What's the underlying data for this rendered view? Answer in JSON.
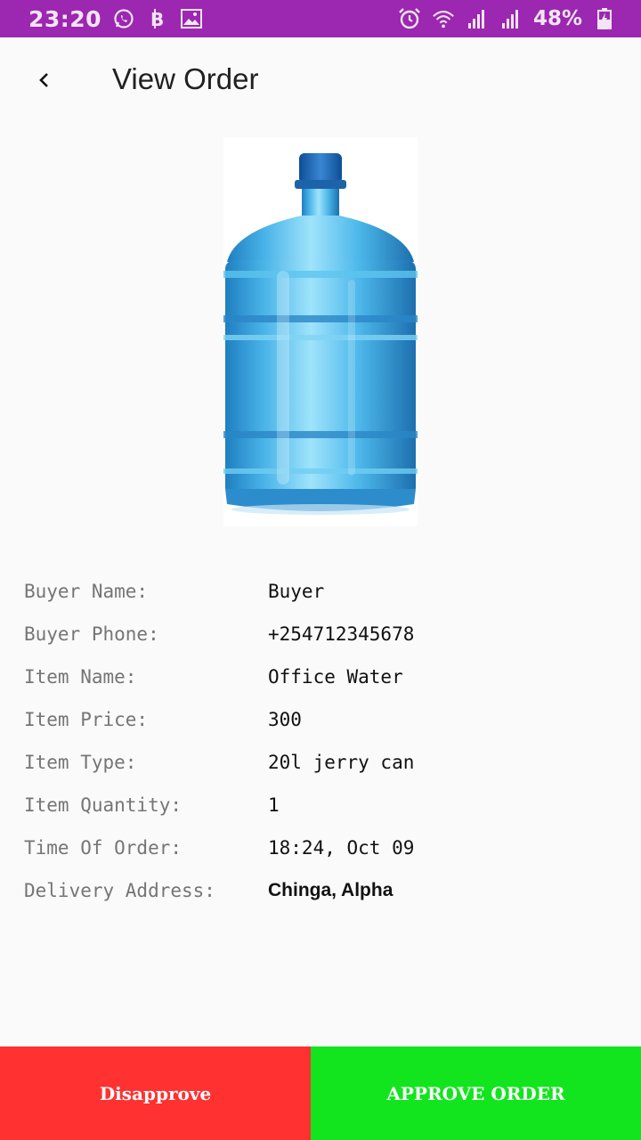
{
  "status_bar": {
    "time": "23:20",
    "battery": "48%",
    "icons_left": [
      "whatsapp-icon",
      "bitcoin-icon",
      "image-icon"
    ],
    "icons_right": [
      "alarm-icon",
      "wifi-icon",
      "signal-icon",
      "signal-icon",
      "battery-charging-icon"
    ],
    "color": "#9c27b0"
  },
  "app_bar": {
    "back_icon": "chevron-left-icon",
    "title": "View Order"
  },
  "product": {
    "image_icon": "water-bottle-image"
  },
  "details": [
    {
      "label": "Buyer Name:",
      "value": "Buyer"
    },
    {
      "label": "Buyer Phone:",
      "value": "+254712345678"
    },
    {
      "label": "Item Name:",
      "value": "Office Water"
    },
    {
      "label": "Item Price:",
      "value": "300"
    },
    {
      "label": "Item Type:",
      "value": "20l jerry can"
    },
    {
      "label": "Item Quantity:",
      "value": "1"
    },
    {
      "label": "Time Of Order:",
      "value": "18:24, Oct 09"
    },
    {
      "label": "Delivery Address:",
      "value": "Chinga, Alpha"
    }
  ],
  "actions": {
    "disapprove_label": "Disapprove",
    "approve_label": "APPROVE ORDER",
    "disapprove_color": "#ff3131",
    "approve_color": "#12e51e"
  }
}
